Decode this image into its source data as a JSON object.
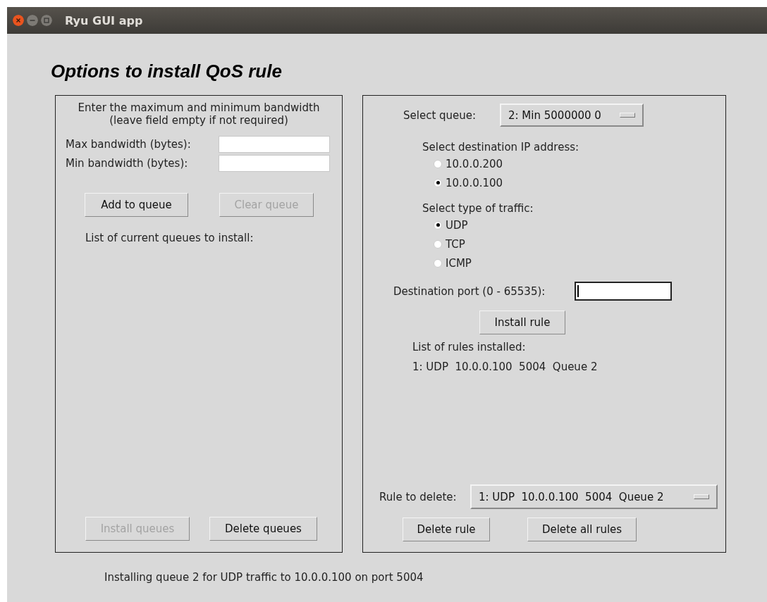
{
  "window": {
    "title": "Ryu GUI app"
  },
  "heading": "Options to install QoS rule",
  "bandwidth_panel": {
    "instructions": [
      "Enter the maximum and minimum bandwidth",
      "(leave field empty if not required)"
    ],
    "fields": [
      {
        "label": "Max bandwidth (bytes):"
      },
      {
        "label": "Min bandwidth (bytes):"
      }
    ],
    "buttons": [
      {
        "label": "Add to queue",
        "disabled": false
      },
      {
        "label": "Clear queue",
        "disabled": true
      }
    ],
    "queue_list_label": "List of current queues to install:",
    "bottom_buttons": [
      {
        "label": "Install queues",
        "disabled": true
      },
      {
        "label": "Delete queues",
        "disabled": false
      }
    ]
  },
  "rule_panel": {
    "queue_select": {
      "label": "Select queue:",
      "value": "2: Min 5000000 0"
    },
    "destination_ip": {
      "label": "Select destination IP address:",
      "options": [
        {
          "label": "10.0.0.200",
          "selected": false
        },
        {
          "label": "10.0.0.100",
          "selected": true
        }
      ]
    },
    "traffic_type": {
      "label": "Select type of traffic:",
      "options": [
        {
          "label": "UDP",
          "selected": true
        },
        {
          "label": "TCP",
          "selected": false
        },
        {
          "label": "ICMP",
          "selected": false
        }
      ]
    },
    "port_field": {
      "label": "Destination port (0 - 65535):",
      "focused": true
    },
    "install_button": {
      "label": "Install rule",
      "disabled": false
    },
    "rules_label": "List of rules installed:",
    "rules": [
      "1: UDP  10.0.0.100  5004  Queue 2"
    ],
    "delete_select": {
      "label": "Rule to delete:",
      "value": "1: UDP  10.0.0.100  5004  Queue 2"
    },
    "delete_buttons": [
      {
        "label": "Delete rule",
        "disabled": false
      },
      {
        "label": "Delete all rules",
        "disabled": false
      }
    ]
  },
  "status": "Installing queue 2 for UDP traffic to 10.0.0.100 on port 5004"
}
